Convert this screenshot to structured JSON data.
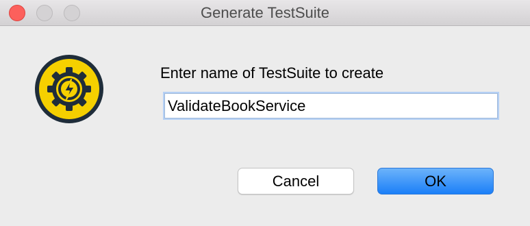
{
  "window": {
    "title": "Generate TestSuite"
  },
  "dialog": {
    "prompt": "Enter name of TestSuite to create",
    "name_value": "ValidateBookService",
    "icon": "gear-lightning-icon"
  },
  "buttons": {
    "cancel_label": "Cancel",
    "ok_label": "OK"
  },
  "colors": {
    "icon_fill": "#f5d000",
    "icon_outline": "#1f2d3a",
    "ok_button": "#1b7ff8",
    "close_light": "#fc605c"
  }
}
